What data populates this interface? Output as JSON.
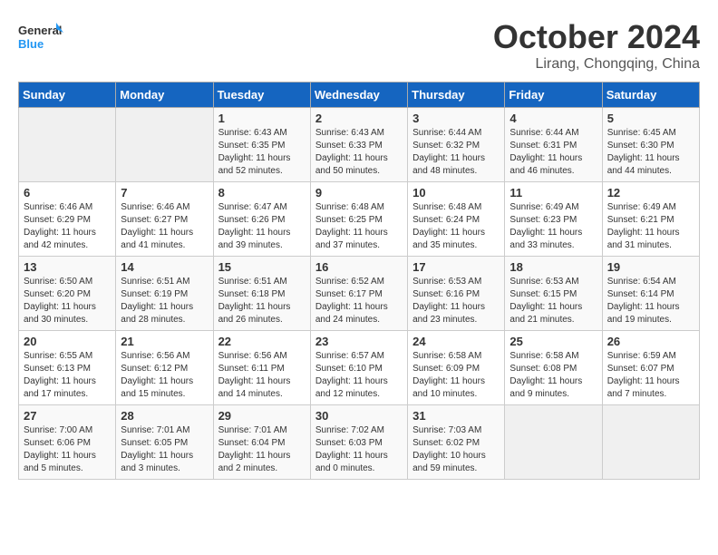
{
  "header": {
    "logo_line1": "General",
    "logo_line2": "Blue",
    "month_title": "October 2024",
    "location": "Lirang, Chongqing, China"
  },
  "weekdays": [
    "Sunday",
    "Monday",
    "Tuesday",
    "Wednesday",
    "Thursday",
    "Friday",
    "Saturday"
  ],
  "weeks": [
    [
      {
        "day": "",
        "sunrise": "",
        "sunset": "",
        "daylight": ""
      },
      {
        "day": "",
        "sunrise": "",
        "sunset": "",
        "daylight": ""
      },
      {
        "day": "1",
        "sunrise": "Sunrise: 6:43 AM",
        "sunset": "Sunset: 6:35 PM",
        "daylight": "Daylight: 11 hours and 52 minutes."
      },
      {
        "day": "2",
        "sunrise": "Sunrise: 6:43 AM",
        "sunset": "Sunset: 6:33 PM",
        "daylight": "Daylight: 11 hours and 50 minutes."
      },
      {
        "day": "3",
        "sunrise": "Sunrise: 6:44 AM",
        "sunset": "Sunset: 6:32 PM",
        "daylight": "Daylight: 11 hours and 48 minutes."
      },
      {
        "day": "4",
        "sunrise": "Sunrise: 6:44 AM",
        "sunset": "Sunset: 6:31 PM",
        "daylight": "Daylight: 11 hours and 46 minutes."
      },
      {
        "day": "5",
        "sunrise": "Sunrise: 6:45 AM",
        "sunset": "Sunset: 6:30 PM",
        "daylight": "Daylight: 11 hours and 44 minutes."
      }
    ],
    [
      {
        "day": "6",
        "sunrise": "Sunrise: 6:46 AM",
        "sunset": "Sunset: 6:29 PM",
        "daylight": "Daylight: 11 hours and 42 minutes."
      },
      {
        "day": "7",
        "sunrise": "Sunrise: 6:46 AM",
        "sunset": "Sunset: 6:27 PM",
        "daylight": "Daylight: 11 hours and 41 minutes."
      },
      {
        "day": "8",
        "sunrise": "Sunrise: 6:47 AM",
        "sunset": "Sunset: 6:26 PM",
        "daylight": "Daylight: 11 hours and 39 minutes."
      },
      {
        "day": "9",
        "sunrise": "Sunrise: 6:48 AM",
        "sunset": "Sunset: 6:25 PM",
        "daylight": "Daylight: 11 hours and 37 minutes."
      },
      {
        "day": "10",
        "sunrise": "Sunrise: 6:48 AM",
        "sunset": "Sunset: 6:24 PM",
        "daylight": "Daylight: 11 hours and 35 minutes."
      },
      {
        "day": "11",
        "sunrise": "Sunrise: 6:49 AM",
        "sunset": "Sunset: 6:23 PM",
        "daylight": "Daylight: 11 hours and 33 minutes."
      },
      {
        "day": "12",
        "sunrise": "Sunrise: 6:49 AM",
        "sunset": "Sunset: 6:21 PM",
        "daylight": "Daylight: 11 hours and 31 minutes."
      }
    ],
    [
      {
        "day": "13",
        "sunrise": "Sunrise: 6:50 AM",
        "sunset": "Sunset: 6:20 PM",
        "daylight": "Daylight: 11 hours and 30 minutes."
      },
      {
        "day": "14",
        "sunrise": "Sunrise: 6:51 AM",
        "sunset": "Sunset: 6:19 PM",
        "daylight": "Daylight: 11 hours and 28 minutes."
      },
      {
        "day": "15",
        "sunrise": "Sunrise: 6:51 AM",
        "sunset": "Sunset: 6:18 PM",
        "daylight": "Daylight: 11 hours and 26 minutes."
      },
      {
        "day": "16",
        "sunrise": "Sunrise: 6:52 AM",
        "sunset": "Sunset: 6:17 PM",
        "daylight": "Daylight: 11 hours and 24 minutes."
      },
      {
        "day": "17",
        "sunrise": "Sunrise: 6:53 AM",
        "sunset": "Sunset: 6:16 PM",
        "daylight": "Daylight: 11 hours and 23 minutes."
      },
      {
        "day": "18",
        "sunrise": "Sunrise: 6:53 AM",
        "sunset": "Sunset: 6:15 PM",
        "daylight": "Daylight: 11 hours and 21 minutes."
      },
      {
        "day": "19",
        "sunrise": "Sunrise: 6:54 AM",
        "sunset": "Sunset: 6:14 PM",
        "daylight": "Daylight: 11 hours and 19 minutes."
      }
    ],
    [
      {
        "day": "20",
        "sunrise": "Sunrise: 6:55 AM",
        "sunset": "Sunset: 6:13 PM",
        "daylight": "Daylight: 11 hours and 17 minutes."
      },
      {
        "day": "21",
        "sunrise": "Sunrise: 6:56 AM",
        "sunset": "Sunset: 6:12 PM",
        "daylight": "Daylight: 11 hours and 15 minutes."
      },
      {
        "day": "22",
        "sunrise": "Sunrise: 6:56 AM",
        "sunset": "Sunset: 6:11 PM",
        "daylight": "Daylight: 11 hours and 14 minutes."
      },
      {
        "day": "23",
        "sunrise": "Sunrise: 6:57 AM",
        "sunset": "Sunset: 6:10 PM",
        "daylight": "Daylight: 11 hours and 12 minutes."
      },
      {
        "day": "24",
        "sunrise": "Sunrise: 6:58 AM",
        "sunset": "Sunset: 6:09 PM",
        "daylight": "Daylight: 11 hours and 10 minutes."
      },
      {
        "day": "25",
        "sunrise": "Sunrise: 6:58 AM",
        "sunset": "Sunset: 6:08 PM",
        "daylight": "Daylight: 11 hours and 9 minutes."
      },
      {
        "day": "26",
        "sunrise": "Sunrise: 6:59 AM",
        "sunset": "Sunset: 6:07 PM",
        "daylight": "Daylight: 11 hours and 7 minutes."
      }
    ],
    [
      {
        "day": "27",
        "sunrise": "Sunrise: 7:00 AM",
        "sunset": "Sunset: 6:06 PM",
        "daylight": "Daylight: 11 hours and 5 minutes."
      },
      {
        "day": "28",
        "sunrise": "Sunrise: 7:01 AM",
        "sunset": "Sunset: 6:05 PM",
        "daylight": "Daylight: 11 hours and 3 minutes."
      },
      {
        "day": "29",
        "sunrise": "Sunrise: 7:01 AM",
        "sunset": "Sunset: 6:04 PM",
        "daylight": "Daylight: 11 hours and 2 minutes."
      },
      {
        "day": "30",
        "sunrise": "Sunrise: 7:02 AM",
        "sunset": "Sunset: 6:03 PM",
        "daylight": "Daylight: 11 hours and 0 minutes."
      },
      {
        "day": "31",
        "sunrise": "Sunrise: 7:03 AM",
        "sunset": "Sunset: 6:02 PM",
        "daylight": "Daylight: 10 hours and 59 minutes."
      },
      {
        "day": "",
        "sunrise": "",
        "sunset": "",
        "daylight": ""
      },
      {
        "day": "",
        "sunrise": "",
        "sunset": "",
        "daylight": ""
      }
    ]
  ]
}
